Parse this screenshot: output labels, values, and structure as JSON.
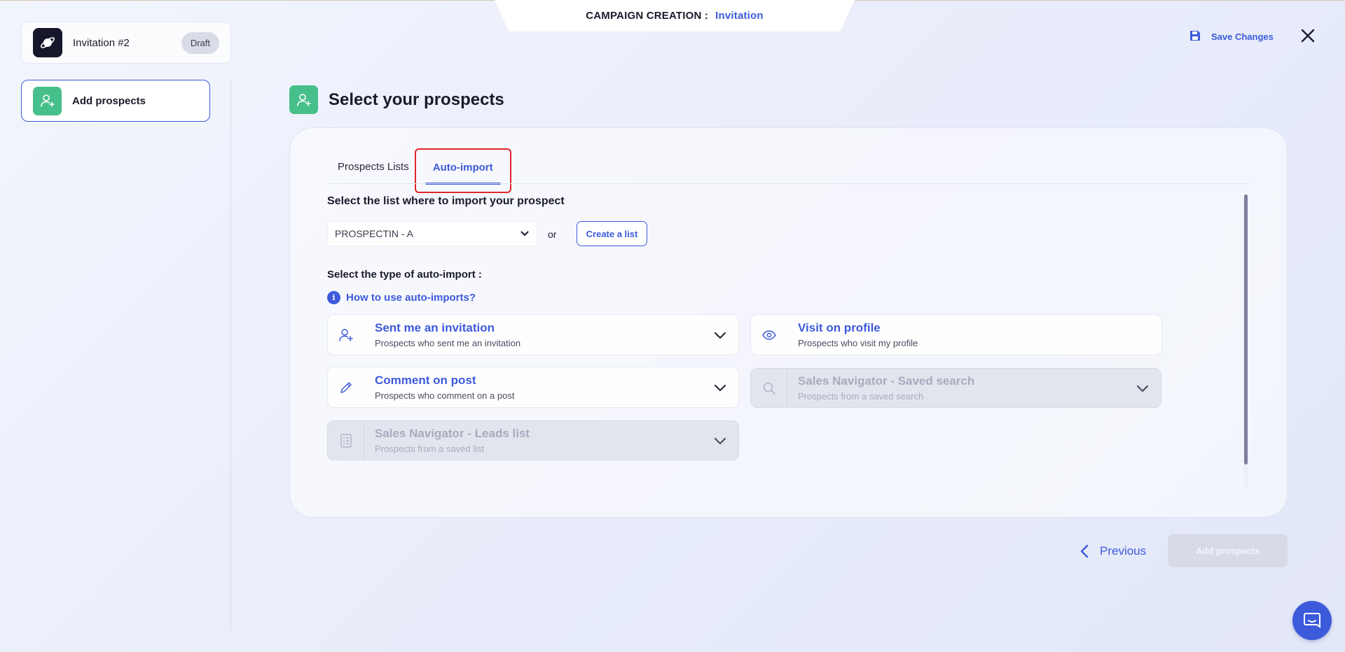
{
  "header": {
    "label": "CAMPAIGN CREATION :",
    "value": "Invitation"
  },
  "toolbar": {
    "save_label": "Save Changes"
  },
  "campaign": {
    "name": "Invitation #2",
    "status": "Draft"
  },
  "sidebar": {
    "items": [
      {
        "label": "Add prospects"
      }
    ]
  },
  "main": {
    "title": "Select your prospects",
    "tabs": [
      {
        "label": "Prospects Lists"
      },
      {
        "label": "Auto-import"
      }
    ],
    "list_question": "Select the list where to import your prospect",
    "selected_list": "PROSPECTIN - A",
    "or_text": "or",
    "create_list_label": "Create a list",
    "type_question": "Select the type of auto-import :",
    "help_icon_text": "i",
    "help_link": "How to use auto-imports?",
    "options": [
      {
        "title": "Sent me an invitation",
        "subtitle": "Prospects who sent me an invitation",
        "icon": "user-plus-icon",
        "disabled": false
      },
      {
        "title": "Visit on profile",
        "subtitle": "Prospects who visit my profile",
        "icon": "eye-icon",
        "disabled": false
      },
      {
        "title": "Comment on post",
        "subtitle": "Prospects who comment on a post",
        "icon": "pencil-icon",
        "disabled": false
      },
      {
        "title": "Sales Navigator - Saved search",
        "subtitle": "Prospects from a saved search",
        "icon": "search-icon",
        "disabled": true
      },
      {
        "title": "Sales Navigator - Leads list",
        "subtitle": "Prospects from a saved list",
        "icon": "list-icon",
        "disabled": true
      }
    ]
  },
  "footer": {
    "previous_label": "Previous",
    "add_label": "Add prospects"
  },
  "colors": {
    "accent": "#3d5adb",
    "green": "#47bf8a",
    "highlight": "#e0262b"
  }
}
